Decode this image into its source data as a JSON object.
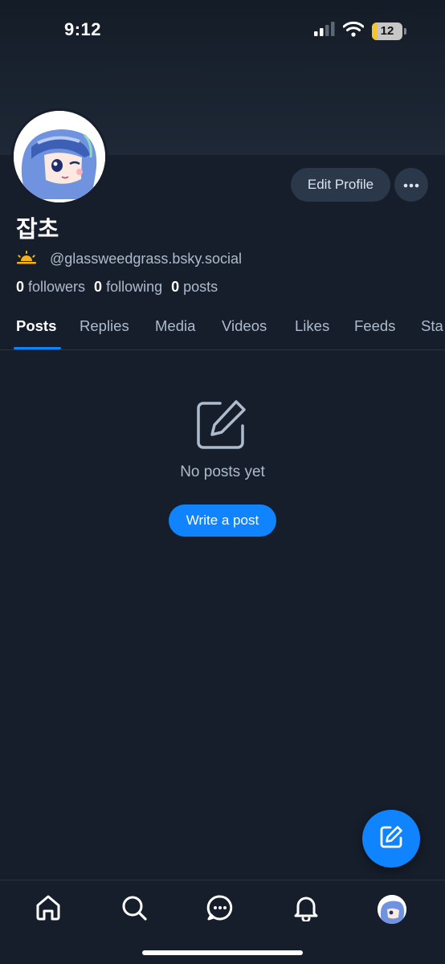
{
  "status_bar": {
    "time": "9:12",
    "battery_level": "12",
    "icons": [
      "signal-icon",
      "wifi-icon",
      "battery-icon"
    ]
  },
  "profile": {
    "display_name": "잡초",
    "handle": "@glassweedgrass.bsky.social",
    "handle_emoji_icon": "sunrise-icon",
    "edit_profile_label": "Edit Profile",
    "followers_count": "0",
    "followers_label": "followers",
    "following_count": "0",
    "following_label": "following",
    "posts_count": "0",
    "posts_label": "posts"
  },
  "tabs": [
    {
      "label": "Posts",
      "active": true
    },
    {
      "label": "Replies",
      "active": false
    },
    {
      "label": "Media",
      "active": false
    },
    {
      "label": "Videos",
      "active": false
    },
    {
      "label": "Likes",
      "active": false
    },
    {
      "label": "Feeds",
      "active": false
    },
    {
      "label": "Sta",
      "active": false
    }
  ],
  "empty_state": {
    "icon": "edit-icon",
    "text": "No posts yet",
    "button_label": "Write a post"
  },
  "bottom_nav": [
    "home-icon",
    "search-icon",
    "chat-icon",
    "bell-icon",
    "avatar"
  ],
  "colors": {
    "background": "#161e2b",
    "accent": "#1083fe",
    "muted_text": "#aebbcc",
    "button_bg": "#2b3849"
  }
}
